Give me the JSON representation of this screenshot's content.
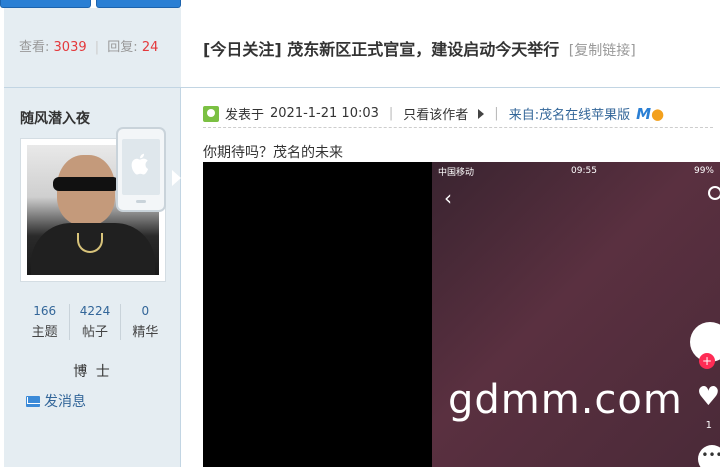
{
  "thread": {
    "views_label": "查看:",
    "views": "3039",
    "sep": "|",
    "replies_label": "回复:",
    "replies": "24",
    "title": "[今日关注] 茂东新区正式官宣，建设启动今天举行",
    "copy_link": "[复制链接]"
  },
  "author": {
    "name": "随风潜入夜",
    "counts": [
      {
        "value": "166",
        "label": "主题"
      },
      {
        "value": "4224",
        "label": "帖子"
      },
      {
        "value": "0",
        "label": "精华"
      }
    ],
    "rank": "博 士",
    "message_label": "发消息",
    "device_icon": "apple-icon"
  },
  "post": {
    "posted_prefix": "发表于",
    "posted_time": "2021-1-21 10:03",
    "only_author": "只看该作者",
    "from": "来自:茂名在线苹果版",
    "text": "你期待吗？茂名的未来",
    "video": {
      "carrier": "中国移动",
      "time": "09:55",
      "battery": "99%",
      "watermark": "gdmm.com",
      "like_count": "1",
      "back_glyph": "‹",
      "plus_glyph": "+",
      "heart_glyph": "♥",
      "more_glyph": "•••"
    }
  },
  "colors": {
    "accent_blue": "#336699",
    "count_red": "#e4393c",
    "sidebar_bg": "#e5edf2"
  }
}
